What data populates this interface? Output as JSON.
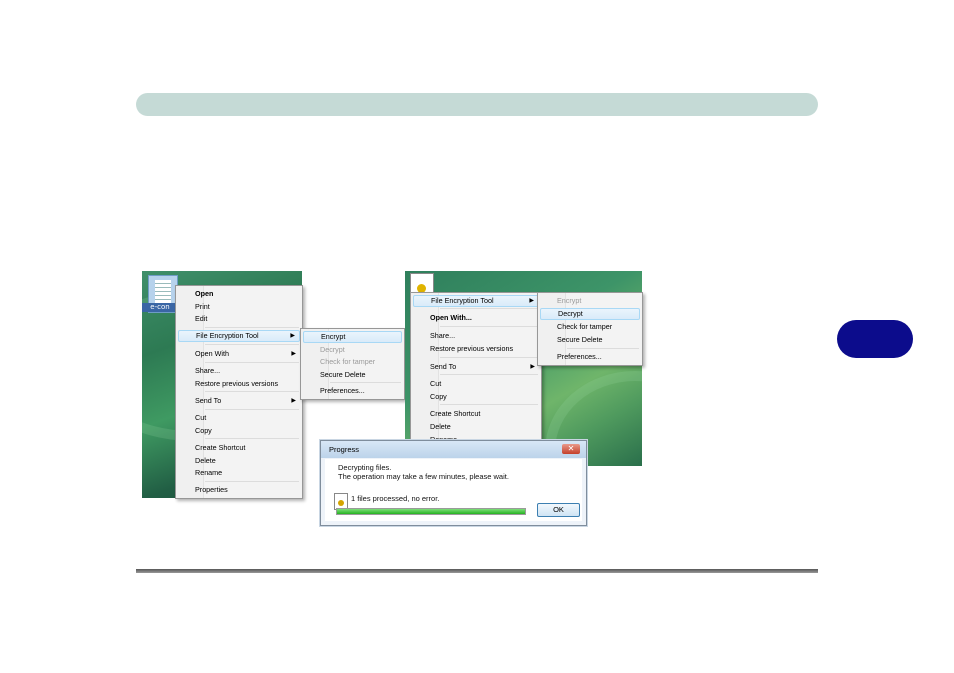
{
  "page": {
    "header_color": "#c5dad6",
    "chapter_tab_color": "#0c0c8c",
    "chapter_tab_label": ""
  },
  "left_screenshot": {
    "file_label": "e-con",
    "menu_items": [
      "Open",
      "Print",
      "Edit",
      "File Encryption Tool",
      "Open With",
      "Share...",
      "Restore previous versions",
      "Send To",
      "Cut",
      "Copy",
      "Create Shortcut",
      "Delete",
      "Rename",
      "Properties"
    ],
    "submenu_items": [
      "Encrypt",
      "Decrypt",
      "Check for tamper",
      "Secure Delete",
      "Preferences..."
    ]
  },
  "right_screenshot": {
    "menu_items": [
      "File Encryption Tool",
      "Open With...",
      "Share...",
      "Restore previous versions",
      "Send To",
      "Cut",
      "Copy",
      "Create Shortcut",
      "Delete",
      "Rename"
    ],
    "submenu_items": [
      "Encrypt",
      "Decrypt",
      "Check for tamper",
      "Secure Delete",
      "Preferences..."
    ]
  },
  "progress_dialog": {
    "title": "Progress",
    "close_symbol": "✕",
    "message_line1": "Decrypting files.",
    "message_line2": "The operation may take a few minutes, please wait.",
    "status": "1 files processed, no error.",
    "progress_fraction": 1.0,
    "ok_label": "OK"
  }
}
